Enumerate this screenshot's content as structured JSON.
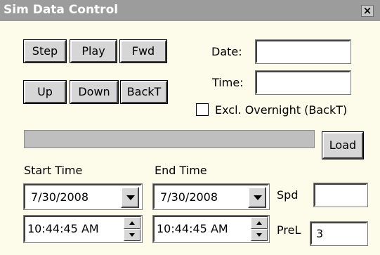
{
  "window": {
    "title": "Sim Data Control",
    "close_symbol": "×"
  },
  "buttons": {
    "step": "Step",
    "play": "Play",
    "fwd": "Fwd",
    "up": "Up",
    "down": "Down",
    "backt": "BackT",
    "load": "Load"
  },
  "fields": {
    "date_label": "Date:",
    "date_value": "",
    "time_label": "Time:",
    "time_value": "",
    "excl_overnight_label": "Excl. Overnight (BackT)",
    "excl_overnight_checked": false,
    "spd_label": "Spd",
    "spd_value": "",
    "prel_label": "PreL",
    "prel_value": "3"
  },
  "start": {
    "label": "Start Time",
    "date": "7/30/2008",
    "time": "10:44:45 AM"
  },
  "end": {
    "label": "End Time",
    "date": "7/30/2008",
    "time": "10:44:45 AM"
  },
  "icons": {
    "close": "close-icon",
    "dropdown": "chevron-down-icon",
    "spin_up": "spin-up-icon",
    "spin_down": "spin-down-icon"
  },
  "colors": {
    "background": "#fdfbe9",
    "titlebar": "#9c9c9c",
    "button_face": "#d6d6d6",
    "progress_track": "#bfbfbf"
  }
}
